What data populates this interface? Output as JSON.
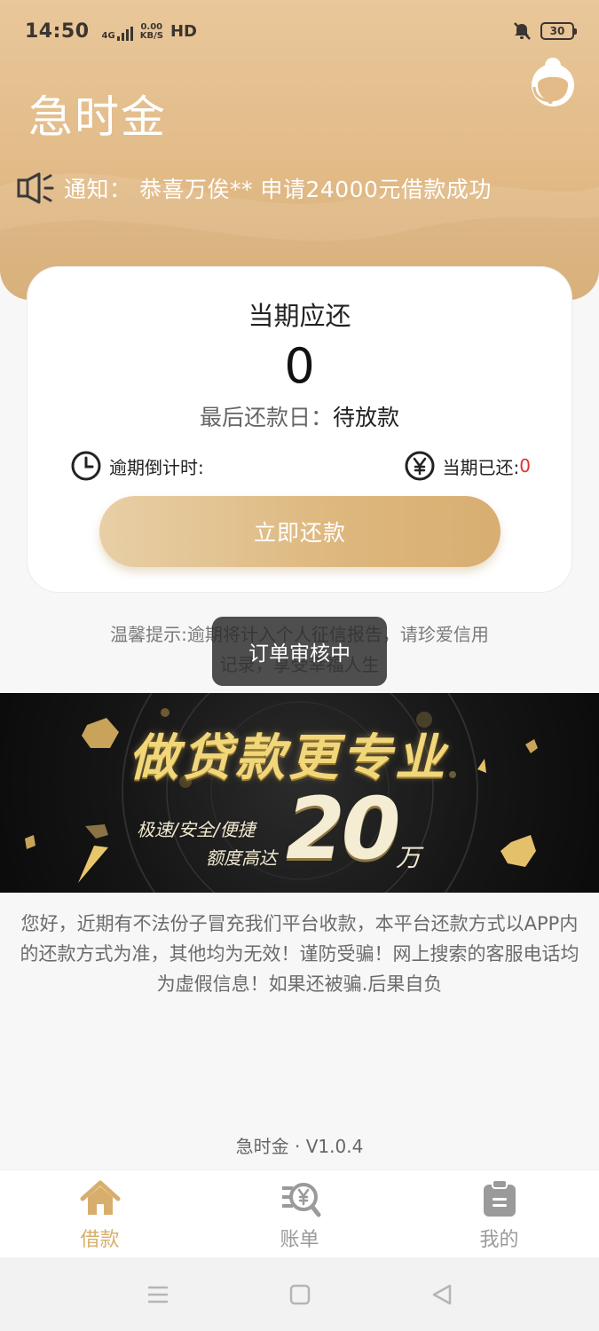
{
  "status_bar": {
    "time": "14:50",
    "network": "4G",
    "speed_value": "0.00",
    "speed_unit": "KB/S",
    "hd": "HD",
    "battery": "30"
  },
  "header": {
    "app_name": "急时金",
    "notice": "通知： 恭喜万俟** 申请24000元借款成功"
  },
  "card": {
    "label": "当期应还",
    "amount": "0",
    "due_label": "最后还款日：",
    "due_value": "待放款",
    "countdown_label": "逾期倒计时:",
    "paid_label": "当期已还:",
    "paid_value": "0",
    "repay_button": "立即还款"
  },
  "tip": "温馨提示:逾期将计入个人征信报告，请珍爱信用记录，享受幸福人生",
  "toast": "订单审核中",
  "banner": {
    "title": "做贷款更专业",
    "sub1": "极速/安全/便捷",
    "sub2": "额度高达",
    "amount": "20",
    "unit": "万"
  },
  "disclaimer": "您好，近期有不法份子冒充我们平台收款，本平台还款方式以APP内的还款方式为准，其他均为无效！谨防受骗！网上搜索的客服电话均为虚假信息！如果还被骗.后果自负",
  "version": "急时金 · V1.0.4",
  "tabs": [
    {
      "label": "借款",
      "icon": "home-icon",
      "active": true
    },
    {
      "label": "账单",
      "icon": "bill-search-icon",
      "active": false
    },
    {
      "label": "我的",
      "icon": "clipboard-icon",
      "active": false
    }
  ],
  "colors": {
    "accent": "#d8ae6d",
    "header": "#e2bb88",
    "overdue_red": "#e0322d"
  }
}
